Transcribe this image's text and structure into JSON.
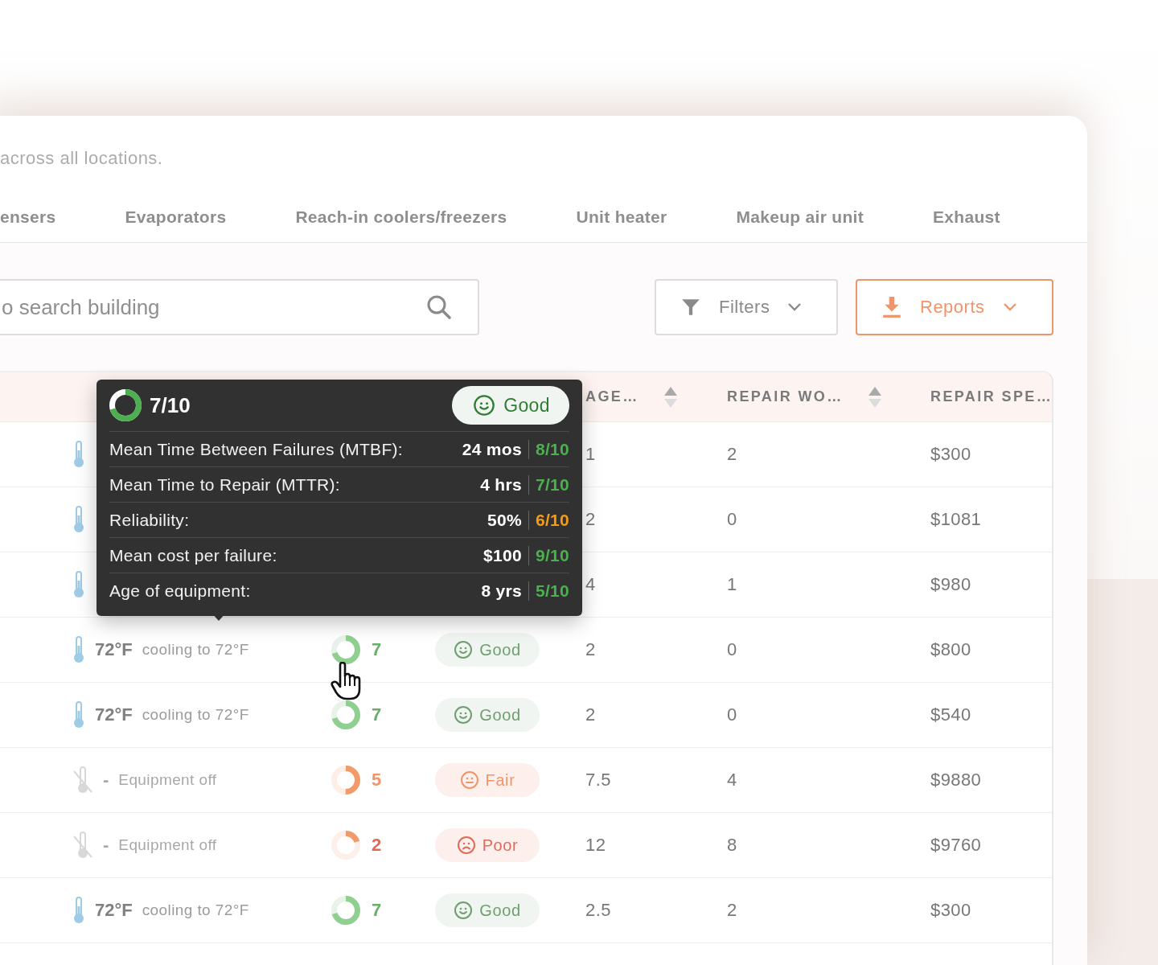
{
  "subtitle": "across all locations.",
  "tabs": [
    {
      "label": "ensers",
      "selected": false
    },
    {
      "label": "Evaporators",
      "selected": false
    },
    {
      "label": "Reach-in coolers/freezers",
      "selected": false
    },
    {
      "label": "Unit heater",
      "selected": false
    },
    {
      "label": "Makeup air unit",
      "selected": false
    },
    {
      "label": "Exhaust",
      "selected": false
    }
  ],
  "search": {
    "placeholder": "o search building"
  },
  "buttons": [
    {
      "label": "Filters",
      "kind": "filter"
    },
    {
      "label": "Reports",
      "kind": "reports"
    }
  ],
  "table": {
    "columns": [
      {
        "label": "AGE…",
        "sortable": true
      },
      {
        "label": "REPAIR WO…",
        "sortable": true
      },
      {
        "label": "REPAIR SPE…",
        "sortable": false
      }
    ],
    "rows": [
      {
        "kind": "on",
        "age": "1",
        "repair_work_orders": "2",
        "repair_spend": "$300"
      },
      {
        "kind": "on",
        "age": "2",
        "repair_work_orders": "0",
        "repair_spend": "$1081"
      },
      {
        "kind": "on",
        "age": "4",
        "repair_work_orders": "1",
        "repair_spend": "$980"
      },
      {
        "kind": "on",
        "temp": "72°F",
        "status_text": "cooling to 72°F",
        "health": {
          "score": "7",
          "level": 0.7,
          "kind": "good",
          "label": "Good"
        },
        "age": "2",
        "repair_work_orders": "0",
        "repair_spend": "$800"
      },
      {
        "kind": "on",
        "temp": "72°F",
        "status_text": "cooling to 72°F",
        "health": {
          "score": "7",
          "level": 0.7,
          "kind": "good",
          "label": "Good"
        },
        "age": "2",
        "repair_work_orders": "0",
        "repair_spend": "$540"
      },
      {
        "kind": "off",
        "temp": "-",
        "status_text": "Equipment off",
        "health": {
          "score": "5",
          "level": 0.5,
          "kind": "fair",
          "label": "Fair"
        },
        "age": "7.5",
        "repair_work_orders": "4",
        "repair_spend": "$9880"
      },
      {
        "kind": "off",
        "temp": "-",
        "status_text": "Equipment off",
        "health": {
          "score": "2",
          "level": 0.2,
          "kind": "poor",
          "label": "Poor"
        },
        "age": "12",
        "repair_work_orders": "8",
        "repair_spend": "$9760"
      },
      {
        "kind": "on",
        "temp": "72°F",
        "status_text": "cooling to 72°F",
        "health": {
          "score": "7",
          "level": 0.7,
          "kind": "good",
          "label": "Good"
        },
        "age": "2.5",
        "repair_work_orders": "2",
        "repair_spend": "$300"
      }
    ]
  },
  "tooltip": {
    "score": "7/10",
    "level": 0.7,
    "kind": "good",
    "label": "Good",
    "metrics": [
      {
        "label": "Mean Time Between Failures (MTBF):",
        "value": "24 mos",
        "score": "8/10",
        "kind": "good"
      },
      {
        "label": "Mean Time to Repair (MTTR):",
        "value": "4 hrs",
        "score": "7/10",
        "kind": "good"
      },
      {
        "label": "Reliability:",
        "value": "50%",
        "score": "6/10",
        "kind": "fair"
      },
      {
        "label": "Mean cost per failure:",
        "value": "$100",
        "score": "9/10",
        "kind": "good"
      },
      {
        "label": "Age of equipment:",
        "value": "8 yrs",
        "score": "5/10",
        "kind": "good"
      }
    ]
  }
}
